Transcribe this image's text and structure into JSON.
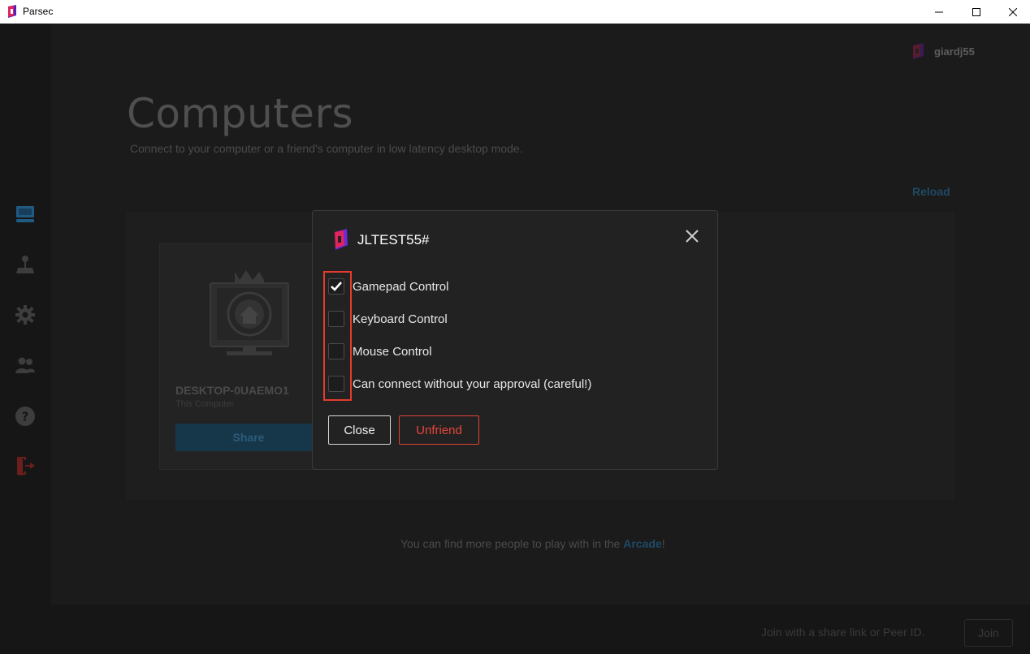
{
  "window": {
    "title": "Parsec",
    "minimize_icon": "minimize-icon",
    "maximize_icon": "maximize-icon",
    "close_icon": "close-icon"
  },
  "sidebar": {
    "items": [
      {
        "id": "computers",
        "icon": "computer-icon",
        "active": true
      },
      {
        "id": "arcade",
        "icon": "joystick-icon",
        "active": false
      },
      {
        "id": "settings",
        "icon": "gear-icon",
        "active": false
      },
      {
        "id": "friends",
        "icon": "friends-icon",
        "active": false
      },
      {
        "id": "help",
        "icon": "help-icon",
        "active": false
      },
      {
        "id": "logout",
        "icon": "logout-icon",
        "active": false
      }
    ]
  },
  "header": {
    "username": "giardj55"
  },
  "page": {
    "title": "Computers",
    "subtitle": "Connect to your computer or a friend's computer in low latency desktop mode.",
    "reload": "Reload"
  },
  "computer_card": {
    "name": "DESKTOP-0UAEMO1",
    "subtitle": "This Computer",
    "share_label": "Share"
  },
  "footer": {
    "prefix": "You can find more people to play with in the ",
    "link": "Arcade",
    "suffix": "!"
  },
  "bottombar": {
    "join_placeholder": "Join with a share link or Peer ID.",
    "join_label": "Join"
  },
  "modal": {
    "title": "JLTEST55#",
    "options": [
      {
        "label": "Gamepad Control",
        "checked": true
      },
      {
        "label": "Keyboard Control",
        "checked": false
      },
      {
        "label": "Mouse Control",
        "checked": false
      },
      {
        "label": "Can connect without your approval (careful!)",
        "checked": false
      }
    ],
    "close_label": "Close",
    "unfriend_label": "Unfriend"
  },
  "colors": {
    "accent_blue": "#2f7fb3",
    "danger_red": "#e8463a",
    "highlight_red": "#e53b2c",
    "brand_pink": "#e0245e"
  }
}
